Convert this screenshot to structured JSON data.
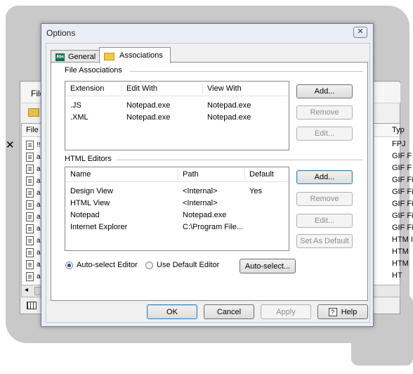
{
  "background_app": {
    "menu_label": "File",
    "list_header": {
      "name": "File N",
      "type": "Typ"
    },
    "file_names": [
      "!!",
      "a",
      "a",
      "a",
      "a",
      "a",
      "a",
      "a",
      "a",
      "a",
      "a",
      "a"
    ],
    "types": [
      "FPJ",
      "GIF F",
      "GIF F",
      "GIF Fi",
      "GIF Fi",
      "GIF Fi",
      "GIF Fil",
      "GIF Fil",
      "HTM I",
      "HTM",
      "HTM",
      "HT"
    ]
  },
  "dialog": {
    "title": "Options",
    "close_glyph": "✕",
    "tabs": [
      {
        "label": "General",
        "icon": "rh-icon",
        "icon_text": "RH",
        "active": false
      },
      {
        "label": "Associations",
        "icon": "folder-icon",
        "active": true
      }
    ],
    "file_associations": {
      "group_label": "File Associations",
      "columns": [
        "Extension",
        "Edit With",
        "View With"
      ],
      "rows": [
        [
          ".JS",
          "Notepad.exe",
          "Notepad.exe"
        ],
        [
          ".XML",
          "Notepad.exe",
          "Notepad.exe"
        ]
      ],
      "buttons": {
        "add": "Add...",
        "remove": "Remove",
        "edit": "Edit..."
      }
    },
    "html_editors": {
      "group_label": "HTML Editors",
      "columns": [
        "Name",
        "Path",
        "Default"
      ],
      "rows": [
        [
          "Design View",
          "<Internal>",
          "Yes"
        ],
        [
          "HTML View",
          "<Internal>",
          ""
        ],
        [
          "Notepad",
          "Notepad.exe",
          ""
        ],
        [
          "Internet Explorer",
          "C:\\Program File...",
          ""
        ]
      ],
      "buttons": {
        "add": "Add...",
        "remove": "Remove",
        "edit": "Edit...",
        "set_default": "Set As Default"
      }
    },
    "editor_mode": {
      "auto_select_label": "Auto-select Editor",
      "use_default_label": "Use Default Editor",
      "selected": "auto_select",
      "auto_select_button": "Auto-select..."
    },
    "footer": {
      "ok": "OK",
      "cancel": "Cancel",
      "apply": "Apply",
      "help": "Help",
      "help_glyph": "?"
    }
  }
}
